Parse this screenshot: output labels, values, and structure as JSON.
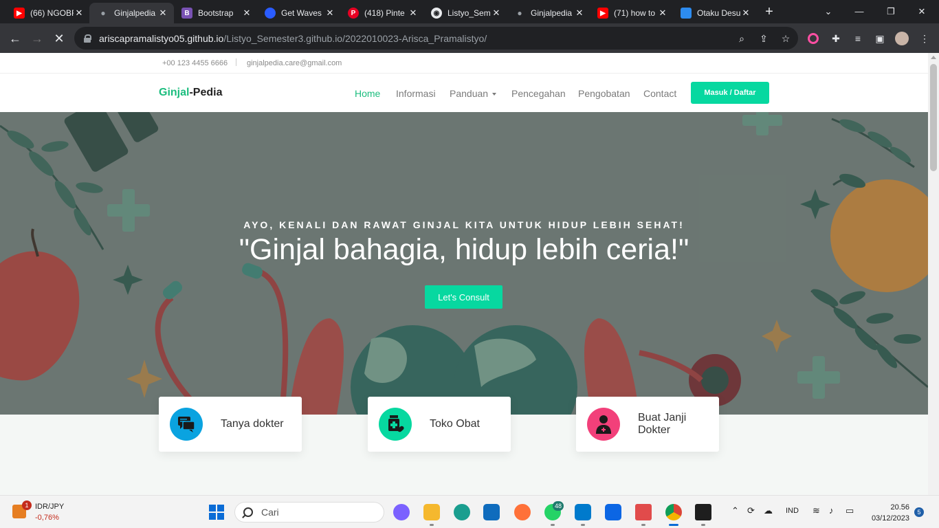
{
  "browser": {
    "tabs": [
      {
        "title": "(66) NGOBR",
        "favicon": "youtube-icon",
        "color": "#ff0000",
        "active": false
      },
      {
        "title": "Ginjalpedia",
        "favicon": "github-icon",
        "color": "#9aa0a6",
        "active": true
      },
      {
        "title": "Bootstrap",
        "favicon": "bootstrap-icon",
        "color": "#7952b3",
        "active": false
      },
      {
        "title": "Get Waves",
        "favicon": "waves-icon",
        "color": "#2a5cff",
        "active": false
      },
      {
        "title": "(418) Pinte",
        "favicon": "pinterest-icon",
        "color": "#e60023",
        "active": false
      },
      {
        "title": "Listyo_Sem",
        "favicon": "github-icon",
        "color": "#e8eaed",
        "active": false
      },
      {
        "title": "Ginjalpedia",
        "favicon": "github-icon",
        "color": "#9aa0a6",
        "active": false
      },
      {
        "title": "(71) how to",
        "favicon": "youtube-icon",
        "color": "#ff0000",
        "active": false
      },
      {
        "title": "Otaku Desu",
        "favicon": "otaku-icon",
        "color": "#2d8cf0",
        "active": false
      }
    ],
    "url_host": "ariscapramalistyo05.github.io",
    "url_path": "/Listyo_Semester3.github.io/2022010023-Arisca_Pramalistyo/"
  },
  "site": {
    "topbar": {
      "phone": "+00 123 4455 6666",
      "email": "ginjalpedia.care@gmail.com"
    },
    "logo": {
      "part1": "Ginjal",
      "part2": "-Pedia"
    },
    "menu": {
      "home": "Home",
      "informasi": "Informasi",
      "panduan": "Panduan",
      "pencegahan": "Pencegahan",
      "pengobatan": "Pengobatan",
      "contact": "Contact",
      "cta": "Masuk / Daftar"
    },
    "hero": {
      "subtitle": "AYO, KENALI DAN RAWAT GINJAL KITA UNTUK HIDUP LEBIH SEHAT!",
      "title": "\"Ginjal bahagia, hidup lebih ceria!\"",
      "button": "Let's Consult"
    },
    "cards": [
      {
        "label": "Tanya dokter",
        "icon": "chat-bubbles-icon",
        "color": "#0aa3e0"
      },
      {
        "label": "Toko Obat",
        "icon": "medicine-bottle-icon",
        "color": "#07d8a0"
      },
      {
        "label": "Buat Janji Dokter",
        "icon": "doctor-icon",
        "color": "#f2407a"
      }
    ],
    "colors": {
      "accent": "#07d8a0",
      "logo_accent": "#1bbd7e"
    }
  },
  "taskbar": {
    "ticker_name": "IDR/JPY",
    "ticker_value": "-0,76%",
    "ticker_badge": "1",
    "search_placeholder": "Cari",
    "whatsapp_badge": "48",
    "language": "IND",
    "time": "20.56",
    "date": "03/12/2023",
    "notification_count": "5"
  }
}
